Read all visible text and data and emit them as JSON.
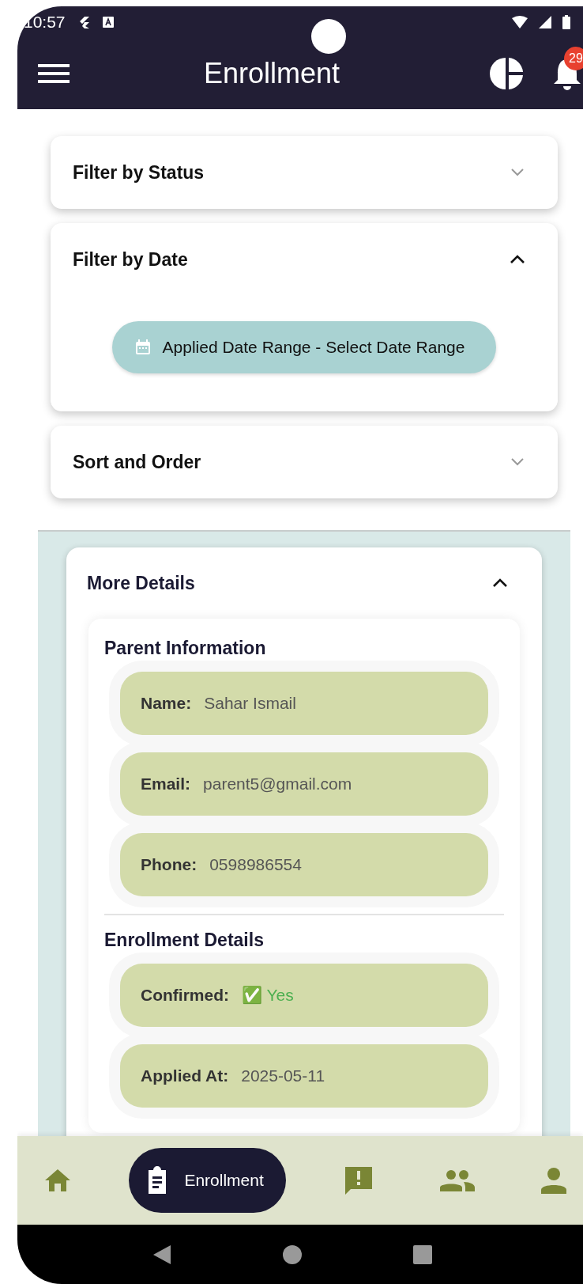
{
  "status_bar": {
    "time": "10:57"
  },
  "app_bar": {
    "title": "Enrollment",
    "notification_count": "29"
  },
  "filters": [
    {
      "title": "Filter by Status",
      "expanded": false
    },
    {
      "title": "Filter by Date",
      "expanded": true,
      "chip": "Applied Date Range - Select Date Range"
    },
    {
      "title": "Sort and Order",
      "expanded": false
    }
  ],
  "details": {
    "title": "More Details",
    "expanded": true,
    "sections": [
      {
        "title": "Parent Information",
        "fields": [
          {
            "kind": "text",
            "label": "Name:",
            "value": "Sahar Ismail"
          },
          {
            "kind": "text",
            "label": "Email:",
            "value": "parent5@gmail.com"
          },
          {
            "kind": "text",
            "label": "Phone:",
            "value": "0598986554"
          }
        ]
      },
      {
        "title": "Enrollment Details",
        "fields": [
          {
            "kind": "status",
            "label": "Confirmed:",
            "value": "✅ Yes"
          },
          {
            "kind": "text",
            "label": "Applied At:",
            "value": "2025-05-11"
          }
        ]
      }
    ]
  },
  "bottom_nav": [
    {
      "selected": false
    },
    {
      "label": "Enrollment",
      "selected": true
    },
    {
      "selected": false
    },
    {
      "selected": false
    },
    {
      "selected": false
    }
  ]
}
